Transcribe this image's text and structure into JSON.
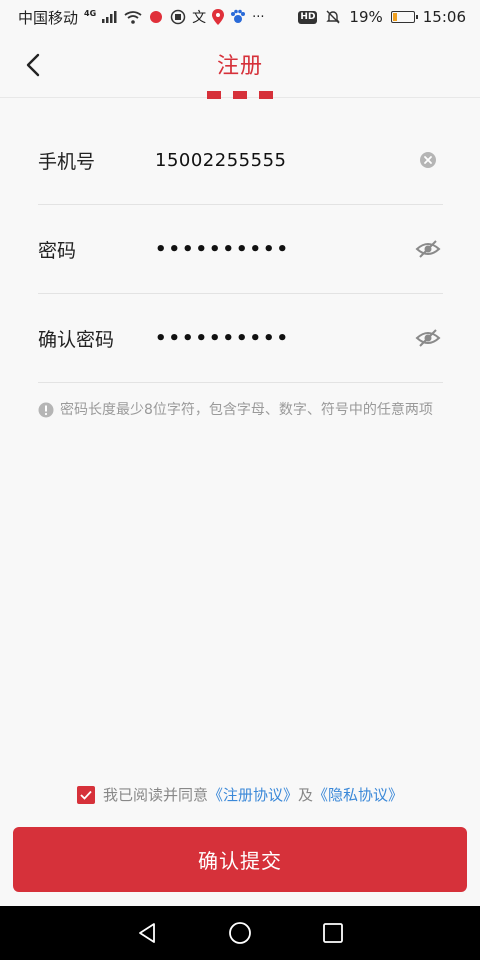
{
  "status_bar": {
    "carrier": "中国移动",
    "network": "4G",
    "battery": "19%",
    "battery_level": 0.19,
    "time": "15:06",
    "hd": "HD",
    "more": "···"
  },
  "header": {
    "title": "注册",
    "accent_color": "#d6313a"
  },
  "form": {
    "phone": {
      "label": "手机号",
      "value": "15002255555"
    },
    "password": {
      "label": "密码",
      "value": "••••••••••"
    },
    "confirm_password": {
      "label": "确认密码",
      "value": "••••••••••"
    }
  },
  "hint": {
    "text": "密码长度最少8位字符，包含字母、数字、符号中的任意两项"
  },
  "agreement": {
    "checked": true,
    "prefix": "我已阅读并同意",
    "register_link": "《注册协议》",
    "and": "及",
    "privacy_link": "《隐私协议》"
  },
  "submit": {
    "label": "确认提交"
  },
  "icons": {
    "back": "chevron-left-icon",
    "clear": "clear-circle-icon",
    "eye_hidden": "eye-off-icon",
    "info": "info-icon",
    "check": "check-icon",
    "nav_back": "triangle-back-icon",
    "nav_home": "circle-home-icon",
    "nav_recent": "square-recent-icon"
  }
}
